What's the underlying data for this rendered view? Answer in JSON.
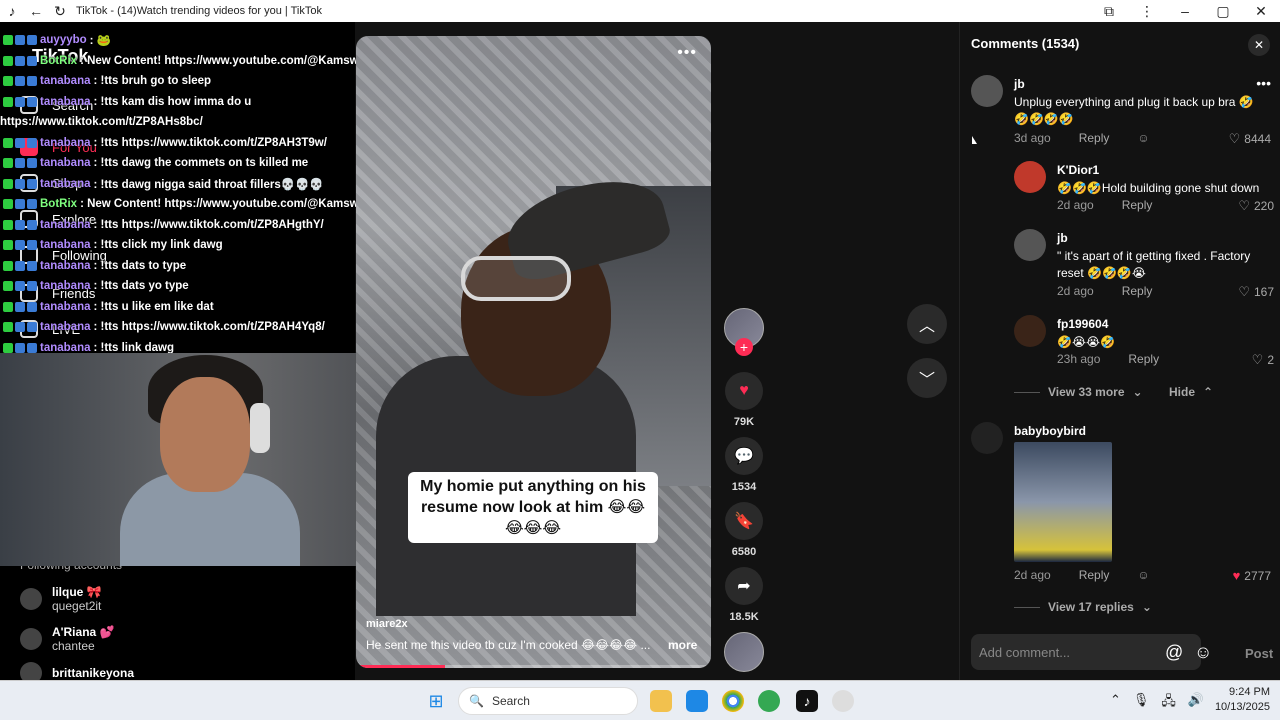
{
  "window": {
    "title": "TikTok - (14)Watch trending videos for you | TikTok"
  },
  "sidebar": {
    "logo": "TikTok",
    "items": [
      {
        "label": "Search"
      },
      {
        "label": "For You"
      },
      {
        "label": "Shop"
      },
      {
        "label": "Explore"
      },
      {
        "label": "Following"
      },
      {
        "label": "Friends"
      },
      {
        "label": "LIVE"
      }
    ],
    "following_title": "Following accounts",
    "accounts": [
      {
        "name": "lilque 🎀",
        "sub": "queget2it"
      },
      {
        "name": "A'Riana 💕",
        "sub": "chantee"
      },
      {
        "name": "brittanikeyona",
        "sub": ""
      }
    ]
  },
  "chat": [
    {
      "user": "auyyybo",
      "text": ": 🐸",
      "kind": "user"
    },
    {
      "user": "BotRix",
      "text": ": New Content! https://www.youtube.com/@Kamswaelive",
      "kind": "bot"
    },
    {
      "user": "tanabana",
      "text": ": !tts bruh go to sleep",
      "kind": "user"
    },
    {
      "user": "tanabana",
      "text": ": !tts kam dis how imma do u",
      "kind": "user"
    },
    {
      "user": "",
      "text": "https://www.tiktok.com/t/ZP8AHs8bc/",
      "kind": "plain"
    },
    {
      "user": "tanabana",
      "text": ": !tts https://www.tiktok.com/t/ZP8AH3T9w/",
      "kind": "user"
    },
    {
      "user": "tanabana",
      "text": ": !tts dawg the commets on ts killed me",
      "kind": "user"
    },
    {
      "user": "tanabana",
      "text": ": !tts dawg nigga said throat fillers💀💀💀",
      "kind": "user"
    },
    {
      "user": "BotRix",
      "text": ": New Content! https://www.youtube.com/@Kamswaelive",
      "kind": "bot"
    },
    {
      "user": "tanabana",
      "text": ": !tts https://www.tiktok.com/t/ZP8AHgthY/",
      "kind": "user"
    },
    {
      "user": "tanabana",
      "text": ": !tts click my link dawg",
      "kind": "user"
    },
    {
      "user": "tanabana",
      "text": ": !tts dats to type",
      "kind": "user"
    },
    {
      "user": "tanabana",
      "text": ": !tts dats yo type",
      "kind": "user"
    },
    {
      "user": "tanabana",
      "text": ": !tts u like em like dat",
      "kind": "user"
    },
    {
      "user": "tanabana",
      "text": ": !tts https://www.tiktok.com/t/ZP8AH4Yq8/",
      "kind": "user"
    },
    {
      "user": "tanabana",
      "text": ": !tts link dawg",
      "kind": "user"
    }
  ],
  "video": {
    "caption": "My homie put anything on his resume now look at him 😂😂😂😂😂",
    "author": "miare2x",
    "description": "He sent me this video tb cuz I'm cooked 😂😂😂😂 ...",
    "more_label": "more",
    "progress_percent": 25
  },
  "actions": {
    "likes": "79K",
    "comments": "1534",
    "saves": "6580",
    "shares": "18.5K"
  },
  "comments_panel": {
    "title": "Comments (1534)",
    "add_placeholder": "Add comment...",
    "post_label": "Post",
    "reply_label": "Reply",
    "comments": [
      {
        "name": "jb",
        "text": "Unplug everything and plug it back up bra 🤣🤣🤣🤣🤣",
        "time": "3d ago",
        "likes": "8444"
      },
      {
        "name": "K'Dior1",
        "text": "🤣🤣🤣Hold building gone shut down",
        "time": "2d ago",
        "likes": "220"
      },
      {
        "name": "jb",
        "text": "\" it's apart of it getting fixed . Factory reset 🤣🤣🤣😭",
        "time": "2d ago",
        "likes": "167"
      },
      {
        "name": "fp199604",
        "text": "🤣😭😭🤣",
        "time": "23h ago",
        "likes": "2"
      },
      {
        "name": "babyboybird",
        "text": "",
        "time": "2d ago",
        "likes": "2777"
      }
    ],
    "view_more_1": "View 33 more",
    "hide_label": "Hide",
    "view_more_2": "View 17 replies"
  },
  "taskbar": {
    "search_label": "Search",
    "time": "9:24 PM",
    "date": "10/13/2025"
  },
  "colors": {
    "accent": "#fe2c55",
    "panel": "#121212"
  }
}
